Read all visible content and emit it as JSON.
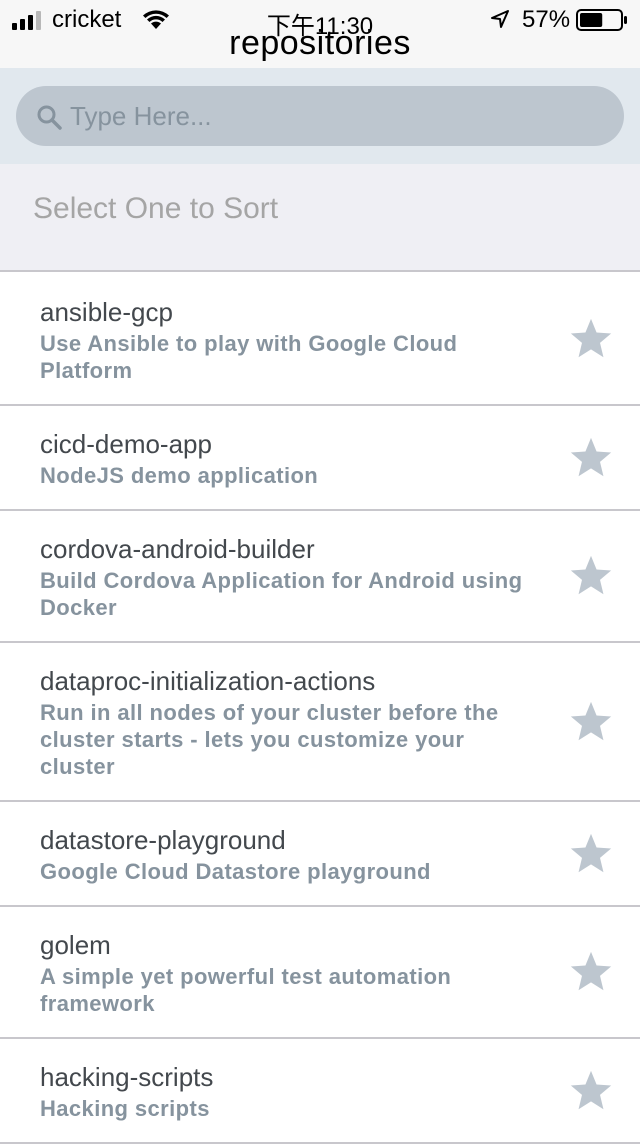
{
  "status_bar": {
    "carrier": "cricket",
    "time": "下午11:30",
    "battery": "57%",
    "battery_level": 0.57
  },
  "header": {
    "title": "repositories"
  },
  "search": {
    "placeholder": "Type Here...",
    "value": ""
  },
  "sort": {
    "label": "Select One to Sort"
  },
  "repositories": [
    {
      "name": "ansible-gcp",
      "description": "Use Ansible to play with Google Cloud Platform"
    },
    {
      "name": "cicd-demo-app",
      "description": "NodeJS demo application"
    },
    {
      "name": "cordova-android-builder",
      "description": "Build Cordova Application for Android using Docker"
    },
    {
      "name": "dataproc-initialization-actions",
      "description": "Run in all nodes of your cluster before the cluster starts - lets you customize your cluster"
    },
    {
      "name": "datastore-playground",
      "description": "Google Cloud Datastore playground"
    },
    {
      "name": "golem",
      "description": "A simple yet powerful test automation framework"
    },
    {
      "name": "hacking-scripts",
      "description": "Hacking scripts"
    }
  ],
  "icons": {
    "star": "star-icon",
    "search": "search-icon",
    "signal": "cellular-signal-icon",
    "wifi": "wifi-icon",
    "location": "location-arrow-icon",
    "battery": "battery-icon"
  },
  "colors": {
    "star": "#bdc6cf",
    "search_background": "#e1e8ee",
    "search_box": "#bdc6cf",
    "title_text": "#43484d",
    "subtitle_text": "#86939e"
  }
}
